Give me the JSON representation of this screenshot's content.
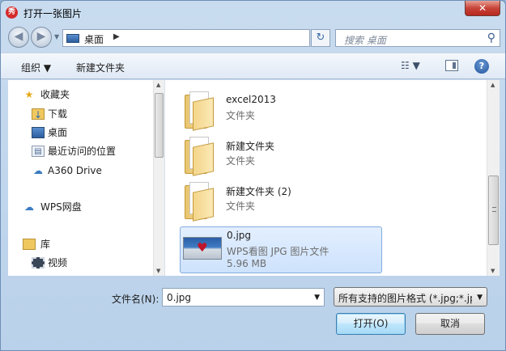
{
  "window": {
    "title": "打开一张图片",
    "close_symbol": "✕",
    "app_icon_glyph": "秀"
  },
  "nav": {
    "back_symbol": "◀",
    "forward_symbol": "▶",
    "address_text": "桌面",
    "address_separator": "▶",
    "dropdown_symbol": "▼",
    "refresh_symbol": "↻",
    "search_placeholder": "搜索 桌面",
    "search_symbol": "⚲"
  },
  "toolbar": {
    "organize_label": "组织 ▼",
    "new_folder_label": "新建文件夹",
    "view_label": "☷ ▼",
    "help_symbol": "?"
  },
  "sidebar": {
    "favorites_label": "收藏夹",
    "downloads_label": "下载",
    "desktop_label": "桌面",
    "recent_label": "最近访问的位置",
    "a360_label": "A360 Drive",
    "wps_label": "WPS网盘",
    "library_label": "库",
    "video_label": "视频"
  },
  "files": [
    {
      "name": "excel2013",
      "type": "文件夹",
      "size": ""
    },
    {
      "name": "新建文件夹",
      "type": "文件夹",
      "size": ""
    },
    {
      "name": "新建文件夹 (2)",
      "type": "文件夹",
      "size": ""
    },
    {
      "name": "0.jpg",
      "type": "WPS看图 JPG 图片文件",
      "size": "5.96 MB"
    }
  ],
  "bottom": {
    "filename_label": "文件名(N):",
    "filename_value": "0.jpg",
    "filetype_value": "所有支持的图片格式 (*.jpg;*.jp",
    "open_label": "打开(O)",
    "cancel_label": "取消"
  },
  "colors": {
    "accent": "#3c7fb1",
    "selection": "#cde2fc",
    "close_red": "#c7443a"
  }
}
